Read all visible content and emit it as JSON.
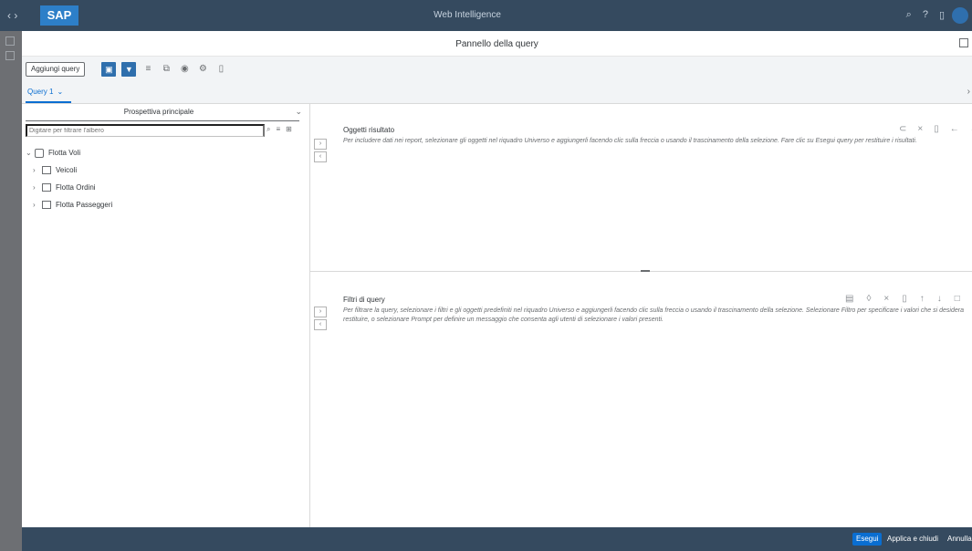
{
  "shellbar": {
    "nav_icons": "‹ ›",
    "logo": "SAP",
    "app_title": "Web Intelligence"
  },
  "dialog": {
    "title": "Pannello della query"
  },
  "toolbar": {
    "add_query_label": "Aggiungi query"
  },
  "tabs": [
    {
      "label": "Query 1"
    }
  ],
  "left_pane": {
    "perspective_label": "Prospettiva principale",
    "search_placeholder": "Digitare per filtrare l'albero",
    "tree": [
      {
        "label": "Flotta Voli",
        "level": 1,
        "expanded": true
      },
      {
        "label": "Veicoli",
        "level": 2,
        "expanded": false
      },
      {
        "label": "Flotta Ordini",
        "level": 2,
        "expanded": false
      },
      {
        "label": "Flotta Passeggeri",
        "level": 2,
        "expanded": false
      }
    ]
  },
  "result_objects": {
    "title": "Oggetti risultato",
    "description": "Per includere dati nei report, selezionare gli oggetti nel riquadro Universo e aggiungerli facendo clic sulla freccia o usando il trascinamento della selezione. Fare clic su Esegui query per restituire i risultati."
  },
  "query_filters": {
    "title": "Filtri di query",
    "description": "Per filtrare la query, selezionare i filtri e gli oggetti predefiniti nel riquadro Universo e aggiungerli facendo clic sulla freccia o usando il trascinamento della selezione. Selezionare Filtro per specificare i valori che si desidera restituire, o selezionare Prompt per definire un messaggio che consenta agli utenti di selezionare i valori presenti."
  },
  "footer": {
    "run_label": "Esegui",
    "apply_close_label": "Applica e chiudi",
    "cancel_label": "Annulla"
  },
  "colors": {
    "shell": "#354a5f",
    "accent": "#0a6ed1",
    "toolbar_bg": "#f2f4f6"
  }
}
